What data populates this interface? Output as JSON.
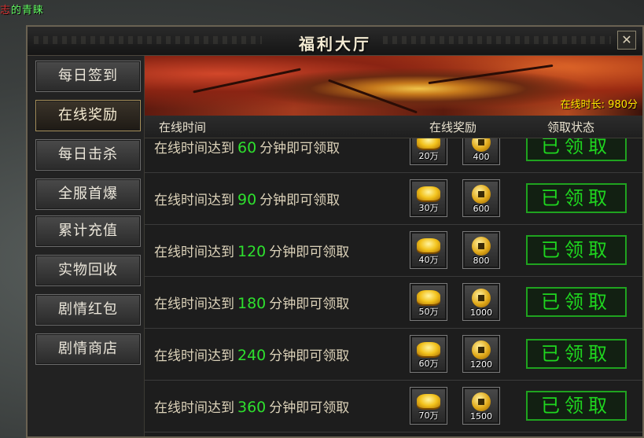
{
  "corner_text": {
    "prefix": "志",
    "name": "的青睐"
  },
  "window": {
    "title": "福利大厅",
    "close_glyph": "✕"
  },
  "sidebar": {
    "items": [
      {
        "label": "每日签到",
        "active": false
      },
      {
        "label": "在线奖励",
        "active": true
      },
      {
        "label": "每日击杀",
        "active": false
      },
      {
        "label": "全服首爆",
        "active": false
      },
      {
        "label": "累计充值",
        "active": false
      },
      {
        "label": "实物回收",
        "active": false
      },
      {
        "label": "剧情红包",
        "active": false
      },
      {
        "label": "剧情商店",
        "active": false
      }
    ]
  },
  "banner": {
    "online_duration": "在线时长: 980分"
  },
  "columns": {
    "time": "在线时间",
    "reward": "在线奖励",
    "status": "领取状态"
  },
  "rows": [
    {
      "prefix": "在线时间达到",
      "minutes": "60",
      "suffix": "分钟即可领取",
      "gold": "20万",
      "coins": "400",
      "status": "已领取"
    },
    {
      "prefix": "在线时间达到",
      "minutes": "90",
      "suffix": "分钟即可领取",
      "gold": "30万",
      "coins": "600",
      "status": "已领取"
    },
    {
      "prefix": "在线时间达到",
      "minutes": "120",
      "suffix": "分钟即可领取",
      "gold": "40万",
      "coins": "800",
      "status": "已领取"
    },
    {
      "prefix": "在线时间达到",
      "minutes": "180",
      "suffix": "分钟即可领取",
      "gold": "50万",
      "coins": "1000",
      "status": "已领取"
    },
    {
      "prefix": "在线时间达到",
      "minutes": "240",
      "suffix": "分钟即可领取",
      "gold": "60万",
      "coins": "1200",
      "status": "已领取"
    },
    {
      "prefix": "在线时间达到",
      "minutes": "360",
      "suffix": "分钟即可领取",
      "gold": "70万",
      "coins": "1500",
      "status": "已领取"
    }
  ],
  "icons": {
    "ingot": "gold-ingot-icon",
    "coin": "copper-coin-icon"
  },
  "colors": {
    "accent_green": "#1fd61f",
    "minutes_green": "#2ee02e",
    "duration_yellow": "#ffe600"
  }
}
